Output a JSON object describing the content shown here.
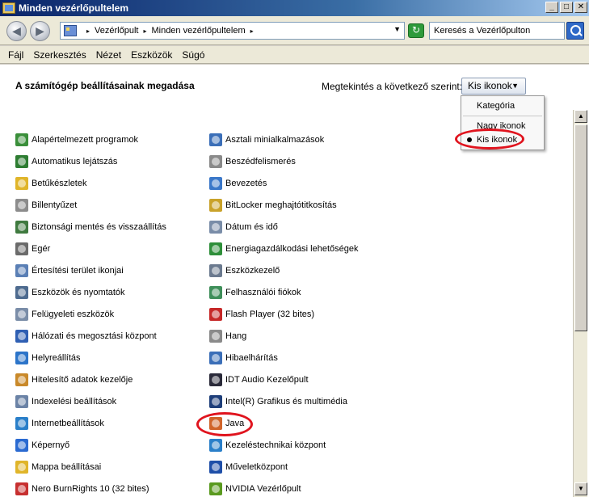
{
  "window": {
    "title": "Minden vezérlőpultelem",
    "minimize": "_",
    "maximize": "□",
    "close": "✕"
  },
  "nav": {
    "back": "◀",
    "forward": "▶",
    "breadcrumb": [
      "Vezérlőpult",
      "Minden vezérlőpultelem"
    ],
    "breadcrumb_sep": "▸",
    "address_drop": "▼",
    "refresh": "↻",
    "search_placeholder": "Keresés a Vezérlőpulton"
  },
  "menu": [
    "Fájl",
    "Szerkesztés",
    "Nézet",
    "Eszközök",
    "Súgó"
  ],
  "header": {
    "title": "A számítógép beállításainak megadása",
    "view_label": "Megtekintés a következő szerint:",
    "view_value": "Kis ikonok",
    "view_arrow": "▼"
  },
  "view_menu": {
    "options": [
      "Kategória",
      "Nagy ikonok",
      "Kis ikonok"
    ],
    "selected": "Kis ikonok"
  },
  "left_items": [
    {
      "label": "Alapértelmezett programok",
      "color": "#3a8f3a"
    },
    {
      "label": "Automatikus lejátszás",
      "color": "#2e7d32"
    },
    {
      "label": "Betűkészletek",
      "color": "#e0b52a"
    },
    {
      "label": "Billentyűzet",
      "color": "#8c8c8c"
    },
    {
      "label": "Biztonsági mentés és visszaállítás",
      "color": "#3f7a3f"
    },
    {
      "label": "Egér",
      "color": "#6b6b6b"
    },
    {
      "label": "Értesítési terület ikonjai",
      "color": "#5a7fb5"
    },
    {
      "label": "Eszközök és nyomtatók",
      "color": "#4e6b8f"
    },
    {
      "label": "Felügyeleti eszközök",
      "color": "#7a8da8"
    },
    {
      "label": "Hálózati és megosztási központ",
      "color": "#2f5fb3"
    },
    {
      "label": "Helyreállítás",
      "color": "#2c74c9"
    },
    {
      "label": "Hitelesítő adatok kezelője",
      "color": "#c9892a"
    },
    {
      "label": "Indexelési beállítások",
      "color": "#6b83a6"
    },
    {
      "label": "Internetbeállítások",
      "color": "#2a7fc9"
    },
    {
      "label": "Képernyő",
      "color": "#2a6ad1"
    },
    {
      "label": "Mappa beállításai",
      "color": "#e0b52a"
    },
    {
      "label": "Nero BurnRights 10 (32 bites)",
      "color": "#c73030"
    }
  ],
  "right_items": [
    {
      "label": "Asztali minialkalmazások",
      "color": "#3b6fb8"
    },
    {
      "label": "Beszédfelismerés",
      "color": "#8a8a8a"
    },
    {
      "label": "Bevezetés",
      "color": "#3b78c9"
    },
    {
      "label": "BitLocker meghajtótitkosítás",
      "color": "#c9a22a"
    },
    {
      "label": "Dátum és idő",
      "color": "#7a8da8"
    },
    {
      "label": "Energiagazdálkodási lehetőségek",
      "color": "#2e8f3a"
    },
    {
      "label": "Eszközkezelő",
      "color": "#6b7a8f"
    },
    {
      "label": "Felhasználói fiókok",
      "color": "#3f8f5a"
    },
    {
      "label": "Flash Player (32 bites)",
      "color": "#c62828"
    },
    {
      "label": "Hang",
      "color": "#8a8a8a"
    },
    {
      "label": "Hibaelhárítás",
      "color": "#3b6fb8"
    },
    {
      "label": "IDT Audio Kezelőpult",
      "color": "#2b2b3a"
    },
    {
      "label": "Intel(R) Grafikus és multimédia",
      "color": "#1f3f7a"
    },
    {
      "label": "Java",
      "color": "#d0642a"
    },
    {
      "label": "Kezeléstechnikai központ",
      "color": "#2a7fc9"
    },
    {
      "label": "Műveletközpont",
      "color": "#1f4fa8"
    },
    {
      "label": "NVIDIA Vezérlőpult",
      "color": "#5a9a1f"
    }
  ]
}
